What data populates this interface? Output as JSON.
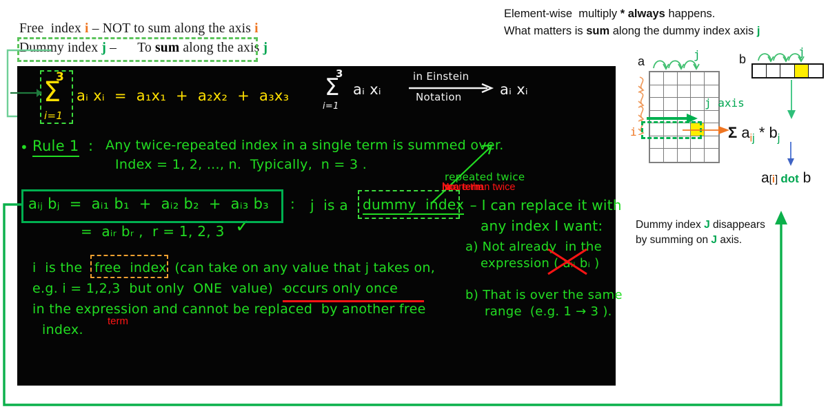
{
  "legend": {
    "line1": {
      "pre": "Free  index ",
      "i1": "i",
      "mid": " – NOT to sum along the axis ",
      "i2": "i"
    },
    "line2": {
      "pre": "Dummy index ",
      "j1": "j",
      "mid1": " –      To ",
      "bold": "sum",
      "mid2": " along the axis ",
      "j2": "j"
    }
  },
  "right_top": {
    "line1_a": "Element-wise  multiply ",
    "line1_b": "* always",
    "line1_c": " happens.",
    "line2_a": "What matters is ",
    "line2_b": "sum",
    "line2_c": " along the dummy index axis ",
    "line2_j": "j"
  },
  "right_bottom": {
    "line1_a": "Dummy index ",
    "line1_j": "J",
    "line1_b": " disappears",
    "line2_a": "by summing on ",
    "line2_j": "J",
    "line2_b": " axis."
  },
  "diagram": {
    "matrix_label": "a",
    "matrix_top_index": "j",
    "matrix_left_index": "i",
    "vector_label": "b",
    "vector_top_index": "j",
    "j_axis_label": "j axis",
    "sum_expr": {
      "sigma": "Σ",
      "a": "a",
      "ij_i": "i",
      "ij_j": "j",
      "star": " * ",
      "b": "b",
      "bj": "j"
    },
    "dot_expr": {
      "a": "a",
      "lb": "[",
      "i": "i",
      "rb": "] ",
      "dot": "dot",
      "b": " b"
    },
    "matrix": {
      "cols": 5,
      "rows": 7,
      "highlight_row": 5,
      "highlight_col": 4
    },
    "vector": {
      "cells": 5,
      "highlight": 4
    }
  },
  "board": {
    "sum_expanded": {
      "sigma": "Σ",
      "upper": "3",
      "lower": "i=1",
      "body": "aᵢ xᵢ  =  a₁x₁  +  a₂x₂  +  a₃x₃"
    },
    "einstein": {
      "sigma": "Σ",
      "upper": "3",
      "lower": "i=1",
      "body": "aᵢ xᵢ",
      "arrow_top": "in Einstein",
      "arrow_bottom": "Notation",
      "result": "aᵢ xᵢ"
    },
    "rule1_bullet": "•",
    "rule1_label": "Rule 1",
    "rule1_colon": ":",
    "rule1_text": "Any twice-repeated index in a single term is summed over.",
    "rule1_text2": "Index = 1, 2, ..., n.  Typically,  n = 3 .",
    "repeated_twice": "repeated twice",
    "no_more_than_twice_a": "No",
    "no_more_than_twice_b": " more than twice ",
    "no_more_than_twice_c": "in a term",
    "eq_boxed": "aᵢⱼ bⱼ  =  aᵢ₁ b₁  +  aᵢ₂ b₂  +  aᵢ₃ b₃",
    "eq_colon": ":",
    "eq_line2": "=  aᵢᵣ bᵣ ,  r = 1, 2, 3",
    "check": "✓",
    "dummy_line_a": "j  is a ",
    "dummy_boxed": "dummy  index",
    "dummy_line_b": " – I can replace it with",
    "dummy_line_c": "any index I want:",
    "clause_a": "a) Not already  in the",
    "clause_a2": "expression ( aᵢᵢ bᵢ )",
    "clause_b": "b) That is over the same",
    "clause_b2": "range  (e.g. 1 → 3 ).",
    "free_line_a": "i  is the ",
    "free_boxed": "free  index",
    "free_line_b": " (can take on any value that j takes on,",
    "free_line2_a": "e.g. i = 1,2,3  but only  ONE  value)  – ",
    "free_line2_b": "occurs only once",
    "free_line3": "in the expression and cannot be replaced  by another free",
    "free_line4": "index.",
    "term_note": "term"
  }
}
